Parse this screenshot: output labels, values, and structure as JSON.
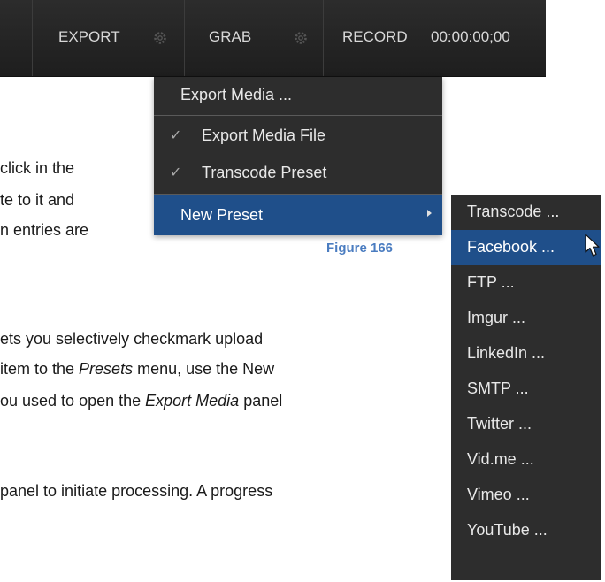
{
  "toolbar": {
    "export_label": "EXPORT",
    "grab_label": "GRAB",
    "record_label": "RECORD",
    "record_timecode": "00:00:00;00",
    "gear_icon": "gear-icon"
  },
  "export_menu": {
    "header": "Export Media ...",
    "items": [
      {
        "label": "Export Media File",
        "checked": true
      },
      {
        "label": "Transcode Preset",
        "checked": true
      }
    ],
    "new_preset": {
      "label": "New Preset",
      "highlighted": true,
      "submenu_indicator": "chevron-right-icon"
    }
  },
  "new_preset_submenu": {
    "items": [
      {
        "label": "Transcode ..."
      },
      {
        "label": "Facebook ...",
        "highlighted": true
      },
      {
        "label": "FTP ..."
      },
      {
        "label": "Imgur ..."
      },
      {
        "label": "LinkedIn ..."
      },
      {
        "label": "SMTP ..."
      },
      {
        "label": "Twitter ..."
      },
      {
        "label": "Vid.me ..."
      },
      {
        "label": "Vimeo ..."
      },
      {
        "label": "YouTube ..."
      }
    ]
  },
  "figure_caption": "Figure 166",
  "document": {
    "line1": "click in the",
    "line2": "te to it and",
    "line3": "n entries are",
    "line4": "ets you selectively checkmark upload",
    "line5_pre": " item to the ",
    "line5_em": "Presets",
    "line5_post": " menu, use the New",
    "line6_pre": "ou used to open the ",
    "line6_em": "Export Media",
    "line6_post": " panel",
    "line7": "panel to initiate processing. A progress"
  },
  "colors": {
    "toolbar_bg": "#232323",
    "menu_bg": "#2d2d2d",
    "highlight": "#1f4f8a",
    "caption": "#4a7cc0"
  }
}
